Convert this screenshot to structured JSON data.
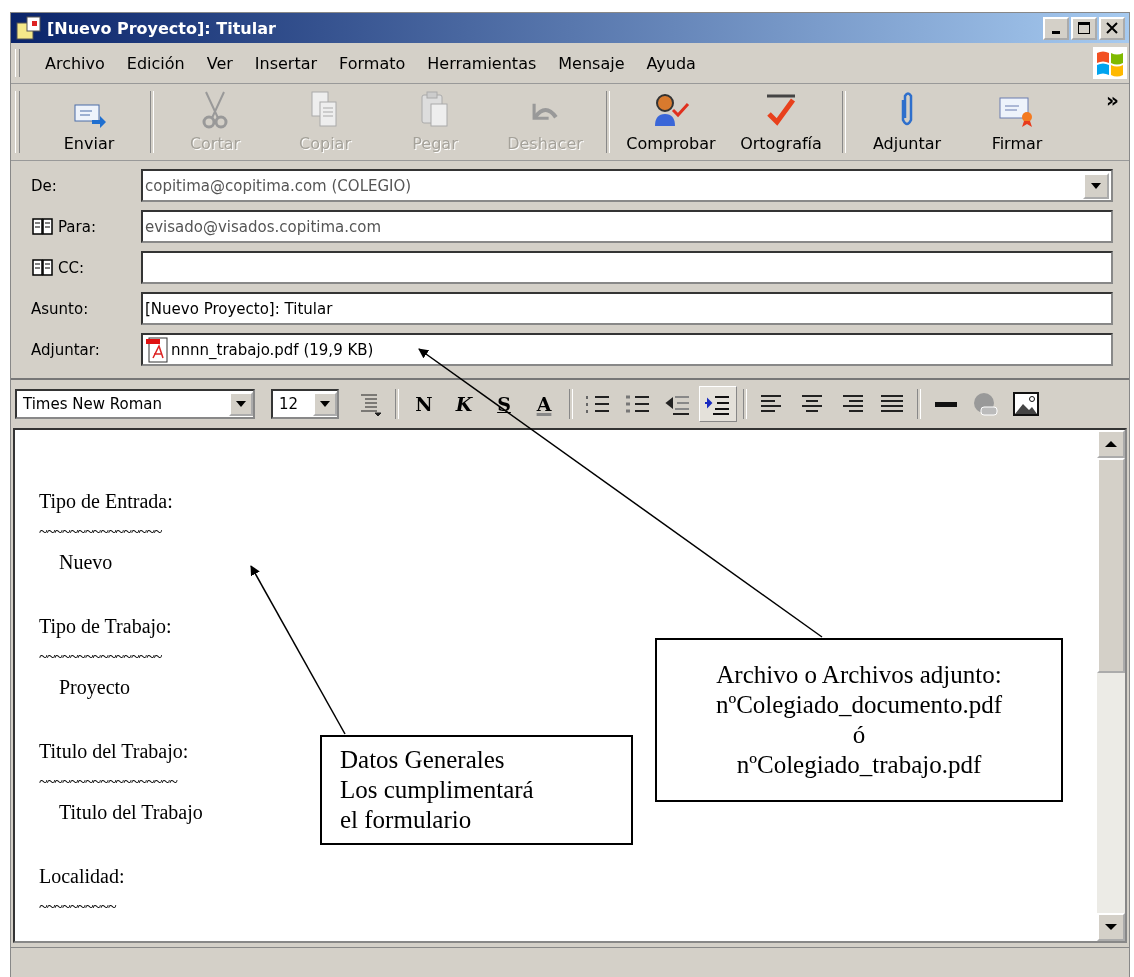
{
  "window": {
    "title": "[Nuevo Proyecto]: Titular"
  },
  "menu": [
    "Archivo",
    "Edición",
    "Ver",
    "Insertar",
    "Formato",
    "Herramientas",
    "Mensaje",
    "Ayuda"
  ],
  "toolbar": [
    [
      {
        "kind": "send",
        "label": "Enviar",
        "disabled": false
      }
    ],
    [
      {
        "kind": "cut",
        "label": "Cortar",
        "disabled": true
      },
      {
        "kind": "copy",
        "label": "Copiar",
        "disabled": true
      },
      {
        "kind": "paste",
        "label": "Pegar",
        "disabled": true
      },
      {
        "kind": "undo",
        "label": "Deshacer",
        "disabled": true
      }
    ],
    [
      {
        "kind": "check",
        "label": "Comprobar",
        "disabled": false
      },
      {
        "kind": "spelling",
        "label": "Ortografía",
        "disabled": false
      }
    ],
    [
      {
        "kind": "attach",
        "label": "Adjuntar",
        "disabled": false
      },
      {
        "kind": "sign",
        "label": "Firmar",
        "disabled": false
      }
    ]
  ],
  "toolbar_more": "»",
  "fields": [
    {
      "kind": "dropdown",
      "label": "De:",
      "value": "copitima@copitima.com    (COLEGIO)"
    },
    {
      "kind": "address",
      "label": "Para:",
      "value": "evisado@visados.copitima.com"
    },
    {
      "kind": "address",
      "label": "CC:"
    },
    {
      "kind": "text",
      "label": "Asunto:",
      "value": "[Nuevo Proyecto]: Titular"
    },
    {
      "kind": "attachment",
      "label": "Adjuntar:",
      "value": "nnnn_trabajo.pdf (19,9 KB)"
    }
  ],
  "format_bar": {
    "font": "Times New Roman",
    "size": "12",
    "groups": [
      [
        {
          "kind": "line-spacing",
          "selected": false
        }
      ],
      [
        {
          "kind": "text",
          "label": "N",
          "selected": false
        },
        {
          "kind": "text",
          "label": "K",
          "selected": false
        },
        {
          "kind": "text",
          "label": "S",
          "selected": false
        },
        {
          "kind": "text",
          "label": "A",
          "selected": false
        }
      ],
      [
        {
          "kind": "numbered-list",
          "selected": false
        },
        {
          "kind": "bullet-list",
          "selected": false
        },
        {
          "kind": "outdent",
          "selected": false
        },
        {
          "kind": "indent",
          "selected": true
        }
      ],
      [
        {
          "kind": "align-left",
          "selected": false
        },
        {
          "kind": "align-center",
          "selected": false
        },
        {
          "kind": "align-right",
          "selected": false
        },
        {
          "kind": "justify",
          "selected": false
        }
      ],
      [
        {
          "kind": "rule",
          "selected": false
        },
        {
          "kind": "globe",
          "selected": false
        },
        {
          "kind": "image",
          "selected": false
        }
      ]
    ]
  },
  "body": [
    {
      "kind": "heading",
      "text": "Tipo de Entrada:"
    },
    {
      "kind": "rule",
      "text": "~~~~~~~~~~~~~~~~"
    },
    {
      "kind": "value",
      "text": "Nuevo"
    },
    {
      "kind": "heading",
      "text": "Tipo de Trabajo:"
    },
    {
      "kind": "rule",
      "text": "~~~~~~~~~~~~~~~~"
    },
    {
      "kind": "value",
      "text": "Proyecto"
    },
    {
      "kind": "heading",
      "text": "Titulo del Trabajo:"
    },
    {
      "kind": "rule",
      "text": "~~~~~~~~~~~~~~~~~~"
    },
    {
      "kind": "value",
      "text": "Titulo del Trabajo"
    },
    {
      "kind": "heading",
      "text": "Localidad:"
    },
    {
      "kind": "rule",
      "text": "~~~~~~~~~~"
    }
  ],
  "callouts": [
    {
      "lines": [
        "Datos Generales",
        "Los cumplimentará",
        "el formulario"
      ]
    },
    {
      "lines": [
        "Archivo o Archivos adjunto:",
        "nºColegiado_documento.pdf",
        "ó",
        "nºColegiado_trabajo.pdf"
      ]
    }
  ]
}
